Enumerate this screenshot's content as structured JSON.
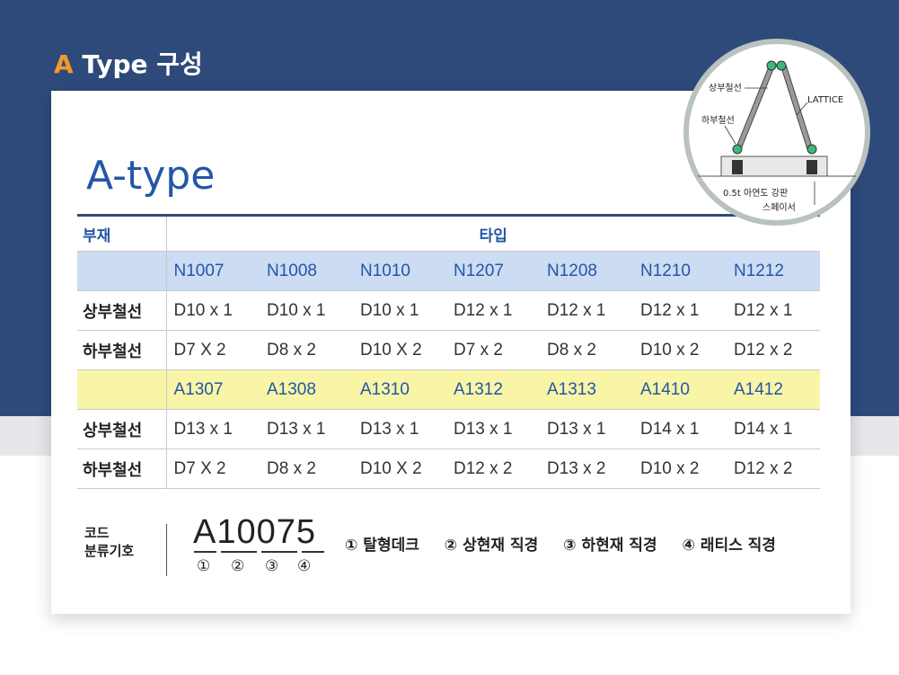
{
  "header": {
    "letter": "A",
    "rest": " Type 구성"
  },
  "title": "A-type",
  "table": {
    "header_left": "부재",
    "header_type": "타입",
    "model_row_1": [
      "N1007",
      "N1008",
      "N1010",
      "N1207",
      "N1208",
      "N1210",
      "N1212"
    ],
    "rows_1": [
      {
        "label": "상부철선",
        "values": [
          "D10 x 1",
          "D10 x 1",
          "D10 x 1",
          "D12 x 1",
          "D12 x 1",
          "D12 x 1",
          "D12 x 1"
        ]
      },
      {
        "label": "하부철선",
        "values": [
          "D7 X 2",
          "D8 x 2",
          "D10 X 2",
          "D7 x 2",
          "D8 x 2",
          "D10 x 2",
          "D12 x 2"
        ]
      }
    ],
    "model_row_2": [
      "A1307",
      "A1308",
      "A1310",
      "A1312",
      "A1313",
      "A1410",
      "A1412"
    ],
    "rows_2": [
      {
        "label": "상부철선",
        "values": [
          "D13 x 1",
          "D13 x 1",
          "D13 x 1",
          "D13 x 1",
          "D13 x 1",
          "D14 x 1",
          "D14 x 1"
        ]
      },
      {
        "label": "하부철선",
        "values": [
          "D7 X 2",
          "D8 x 2",
          "D10 X 2",
          "D12 x 2",
          "D13 x 2",
          "D10 x 2",
          "D12 x 2"
        ]
      }
    ],
    "colors": {
      "model_row_1_bg": "#ccdcf2",
      "model_row_2_bg": "#f8f5a6",
      "accent": "#2456a6"
    }
  },
  "code": {
    "label_line1": "코드",
    "label_line2": "분류기호",
    "example": "A10075",
    "markers": [
      "①",
      "②",
      "③",
      "④"
    ],
    "legend": [
      "① 탈형데크",
      "② 상현재 직경",
      "③ 하현재 직경",
      "④ 래티스 직경"
    ]
  },
  "diagram": {
    "labels": {
      "top_wire": "상부철선",
      "bottom_wire": "하부철선",
      "lattice": "LATTICE",
      "plate": "0.5t 아연도 강판",
      "spacer": "스페이서"
    }
  },
  "colors": {
    "band": "#2d4a7a",
    "orange": "#f39a2b",
    "title_blue": "#2456a6"
  }
}
